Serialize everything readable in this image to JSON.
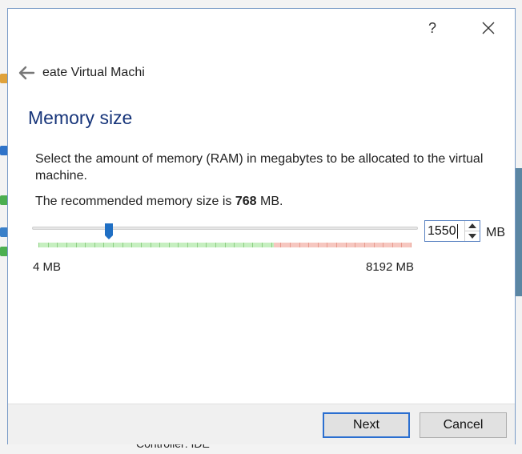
{
  "background": {
    "bottom_text": "Controller: IDE"
  },
  "dialog": {
    "help_label": "?",
    "close_label": "✕",
    "wizard_title": "eate Virtual Machi",
    "page_title": "Memory size",
    "description": "Select the amount of memory (RAM) in megabytes to be allocated to the virtual machine.",
    "recommend_prefix": "The recommended memory size is ",
    "recommend_value": "768",
    "recommend_suffix": " MB.",
    "slider": {
      "value_mb": 1550,
      "min_label": "4 MB",
      "max_label": "8192 MB",
      "min_mb": 4,
      "max_mb": 8192
    },
    "spin_value": "1550",
    "unit_label": "MB",
    "buttons": {
      "next": "Next",
      "cancel": "Cancel"
    }
  },
  "colors": {
    "accent": "#2b6fd0",
    "title": "#17357a",
    "safe_zone": "#c6efc0",
    "warn_zone": "#f6c7c0",
    "thumb": "#1f6fc4"
  }
}
